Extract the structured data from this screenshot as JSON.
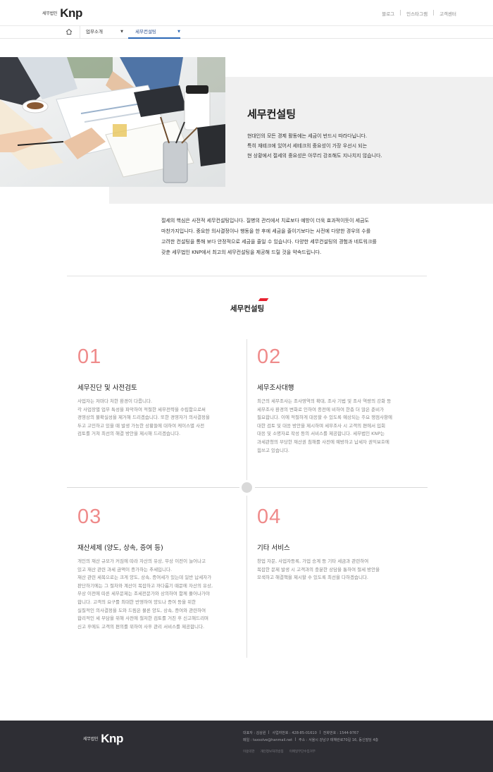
{
  "header": {
    "logo_small": "세무법인",
    "logo_main": "Knp",
    "links": [
      "블로그",
      "인스타그램",
      "고객센터"
    ]
  },
  "subnav": {
    "items": [
      {
        "label": "업무소개"
      },
      {
        "label": "세무컨설팅"
      }
    ]
  },
  "hero": {
    "title": "세무컨설팅",
    "lines": [
      "현대인의 모든 경제 활동에는 세금이 반드시 따라다닙니다.",
      "특히 재테크에 있어서 세테크의 중요성이 가장 우선시 되는",
      "현 상황에서 절세의 중요성은 아무리 강조해도 지나치지 않습니다."
    ]
  },
  "intro": {
    "lines": [
      "절세의 핵심은 사전적 세무컨설팅입니다. 질병의 관리에서 치료보다 예방이 더욱 효과적이듯이 세금도",
      "마찬가지입니다. 중요한 의사결정이나 행동을 한 후에 세금을 줄이기보다는 사전에 다양한 경우의 수를",
      "고려한 컨설팅을 통해 보다 안정적으로 세금을 줄일 수 있습니다. 다양한 세무컨설팅의 경험과 네트워크를",
      "갖춘 세무법인 KNP에서 최고의 세무컨설팅을 제공해 드릴 것을 약속드립니다."
    ]
  },
  "section": {
    "title": "세무컨설팅"
  },
  "services": [
    {
      "num": "01",
      "title": "세무진단 및 사전검토",
      "lines": [
        "사업자는 저마다 처한 환경이 다릅니다.",
        "각 사업장별 업무 특성을 파악하여 적절한 세무전략을 수립함으로써",
        "경영상의 불확실성을 제거해 드리겠습니다. 또한 경영자가 의사결정을",
        "두고 고민하고 있을 때 발생 가능한 상황들에 대하여 케이스별 사전",
        "검토를 거쳐 최선의 해결 방안을 제시해 드리겠습니다."
      ]
    },
    {
      "num": "02",
      "title": "세무조사대행",
      "lines": [
        "최근의 세무조사는 조사영역의 확대, 조사 기법 및 조사 역량의 강화 등",
        "세무조사 환경의 변화로 인하여 종전에 비하여 한층 더 많은 준비가",
        "필요합니다. 이에 적절하게 대응할 수 있도록 예상되는 주요 쟁점사항에",
        "대한 검토 및 대응 방안을 제시하며 세무조사 시 고객의 편에서 입회",
        "대응 및 소명자료 작성 등의 서비스를 제공합니다. 세무법인 KNP는",
        "과세관청의 부당한 재산권 침해를 사전에 예방하고 납세자 권익보호에",
        "힘쓰고 있습니다."
      ]
    },
    {
      "num": "03",
      "title": "재산세제 (양도, 상속, 증여 등)",
      "lines": [
        "개인의 재산 규모가 커짐에 따라 자산의 유상, 무상 이전이 늘어나고",
        "있고 재산 관련 과세 금액이 증가하는 추세입니다.",
        "재산 관련 세목으로는 크게 양도, 상속, 증여세가 있는데 일반 납세자가",
        "판단하기에는 그 절차와 계산이 복잡하고 까다롭기 때문에 자산의 유상,",
        "무상 이전에 따른 세무문제는 조세전문가와 상의하여 함께 풀어나가야",
        "합니다. 고객의 요구를 최대한 반영하여 양도나 증여 등을 위한",
        "실질적인 의사결정을 도와 드림은 물론 양도, 상속, 증여와 관련하여",
        "합리적인 세 부담을 위해 사전에 철저한 검토를 거친 후 신고해드리며",
        "신고 후에도 고객의 편의를 위하여 사후 관리 서비스를 제공합니다."
      ]
    },
    {
      "num": "04",
      "title": "기타 서비스",
      "lines": [
        "창업 자문, 사업자등록, 가업 승계 등 기타 세금과 관련하여",
        "복잡한 문제 발생 시 고객과의 충분한 상담을 통하여 절세 방안을",
        "모색하고 해결책을 제시할 수 있도록 최선을 다하겠습니다."
      ]
    }
  ],
  "footer": {
    "logo_small": "세무법인",
    "logo_main": "Knp",
    "line1": [
      "대표자 : 김상원",
      "사업자번호 : 428-85-01610",
      "전화번호 : 1544-9767"
    ],
    "line2": [
      "메일 : taxsolve@hanmail.net",
      "주소 : 서울시 강남구 테헤란로70길 16, 동신빌딩 4층"
    ],
    "links": [
      "이용약관",
      "개인정보처리방침",
      "이메일무단수집거부"
    ]
  },
  "colors": {
    "accent": "#e8212f",
    "number": "#ef8a8a",
    "footer_bg": "#2e2e34",
    "nav_active": "#2b67b5"
  }
}
